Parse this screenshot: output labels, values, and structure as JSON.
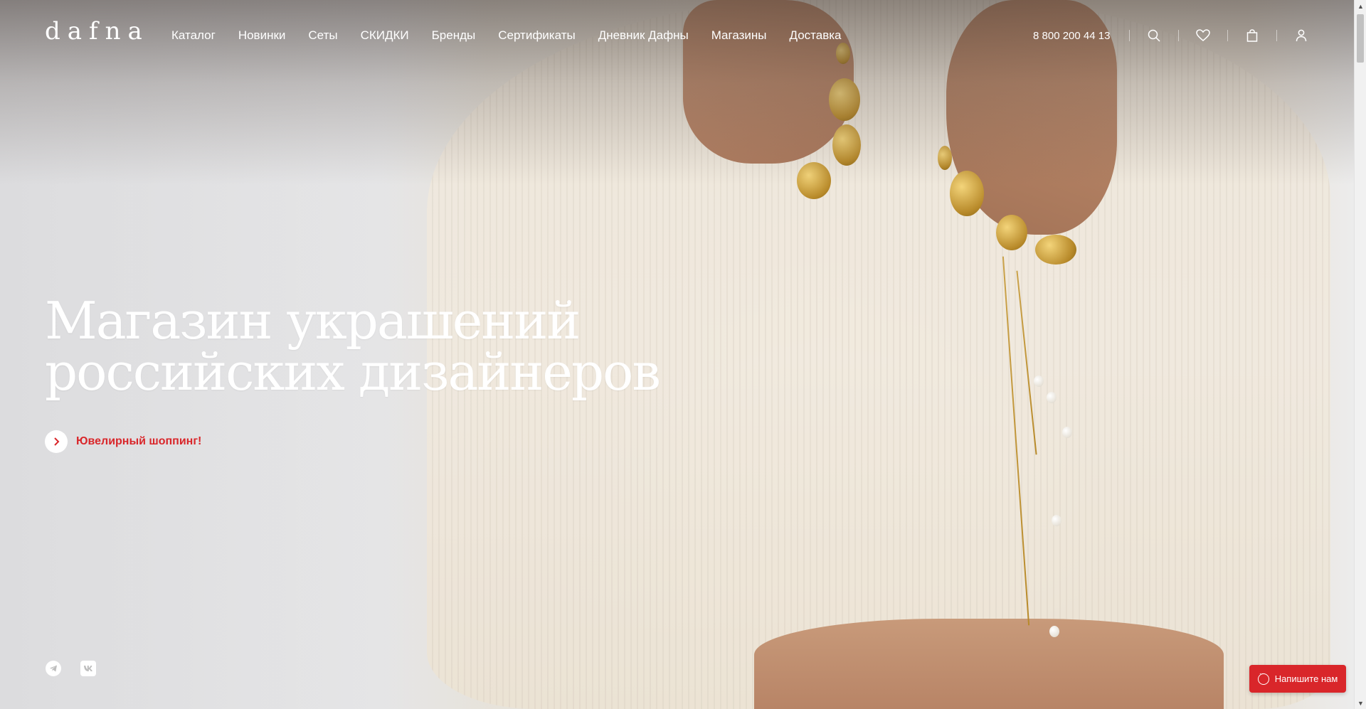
{
  "brand": {
    "logo_text": "dafna"
  },
  "nav": {
    "items": [
      "Каталог",
      "Новинки",
      "Сеты",
      "СКИДКИ",
      "Бренды",
      "Сертификаты",
      "Дневник Дафны",
      "Магазины",
      "Доставка"
    ]
  },
  "header": {
    "phone": "8 800 200 44 13",
    "icons": [
      "search-icon",
      "heart-icon",
      "bag-icon",
      "user-icon"
    ]
  },
  "hero": {
    "title_line1": "Магазин украшений",
    "title_line2": "российских дизайнеров",
    "cta_label": "Ювелирный шоппинг!"
  },
  "social": [
    "telegram-icon",
    "vk-icon"
  ],
  "chat": {
    "label": "Напишите нам"
  },
  "colors": {
    "accent": "#d9262a",
    "text_light": "#ffffff"
  }
}
